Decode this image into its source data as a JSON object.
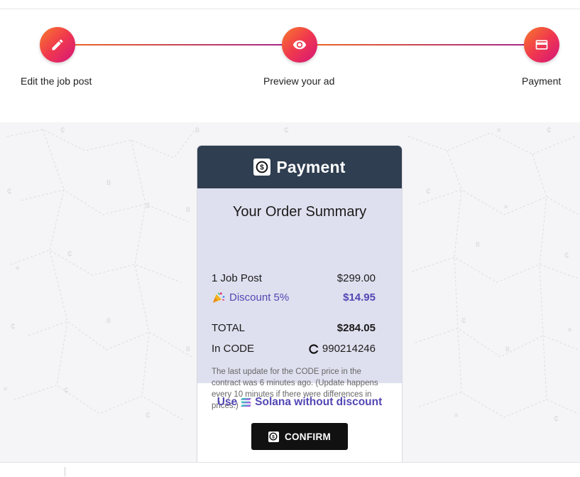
{
  "stepper": {
    "steps": [
      {
        "label": "Edit the job post",
        "icon": "pencil-icon"
      },
      {
        "label": "Preview your ad",
        "icon": "eye-icon"
      },
      {
        "label": "Payment",
        "icon": "credit-card-icon"
      }
    ],
    "accent_gradient": [
      "#f77a2a",
      "#f0384e",
      "#d4157a"
    ]
  },
  "card": {
    "title": "Payment",
    "header_color": "#2f3e50",
    "summary_bg": "#dfe0ef",
    "summary": {
      "title": "Your Order Summary",
      "item_label": "1 Job Post",
      "item_price": "$299.00",
      "discount_label": "Discount 5%",
      "discount_value": "$14.95",
      "total_label": "TOTAL",
      "total_value": "$284.05",
      "code_label": "In CODE",
      "code_value": "990214246",
      "note": "The last update for the CODE price in the contract was 6 minutes ago. (Update happens every 10 minutes if there were differences in prices.)"
    },
    "alt_prefix": "Use",
    "alt_text": "Solana without discount",
    "confirm_label": "CONFIRM",
    "link_color": "#5247b4"
  }
}
